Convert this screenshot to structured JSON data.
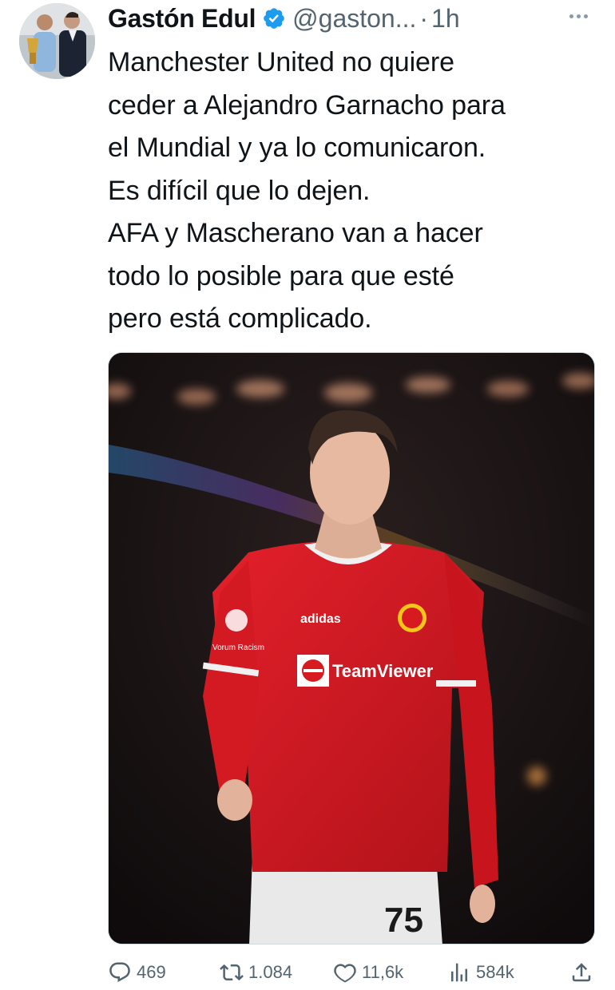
{
  "tweet": {
    "author": {
      "name": "Gastón Edul",
      "handle": "@gaston...",
      "verified": true,
      "verified_color": "#1d9bf0"
    },
    "separator": "·",
    "time": "1h",
    "more_icon": "more-horizontal-icon",
    "text_lines": [
      "Manchester United no quiere",
      "ceder a Alejandro Garnacho para",
      "el Mundial y ya lo comunicaron.",
      "Es difícil que lo dejen.",
      "AFA y Mascherano van a hacer",
      "todo lo posible para que esté",
      "pero está complicado."
    ],
    "media": {
      "shirt_sponsor": "TeamViewer",
      "shirt_brand": "adidas",
      "shirt_number": "75",
      "sleeve_patch": "Vorum Racism"
    },
    "actions": {
      "replies": "469",
      "retweets": "1.084",
      "likes": "11,6k",
      "views": "584k"
    },
    "colors": {
      "text": "#0f1419",
      "secondary": "#536471",
      "shirt_red": "#d71920"
    }
  }
}
